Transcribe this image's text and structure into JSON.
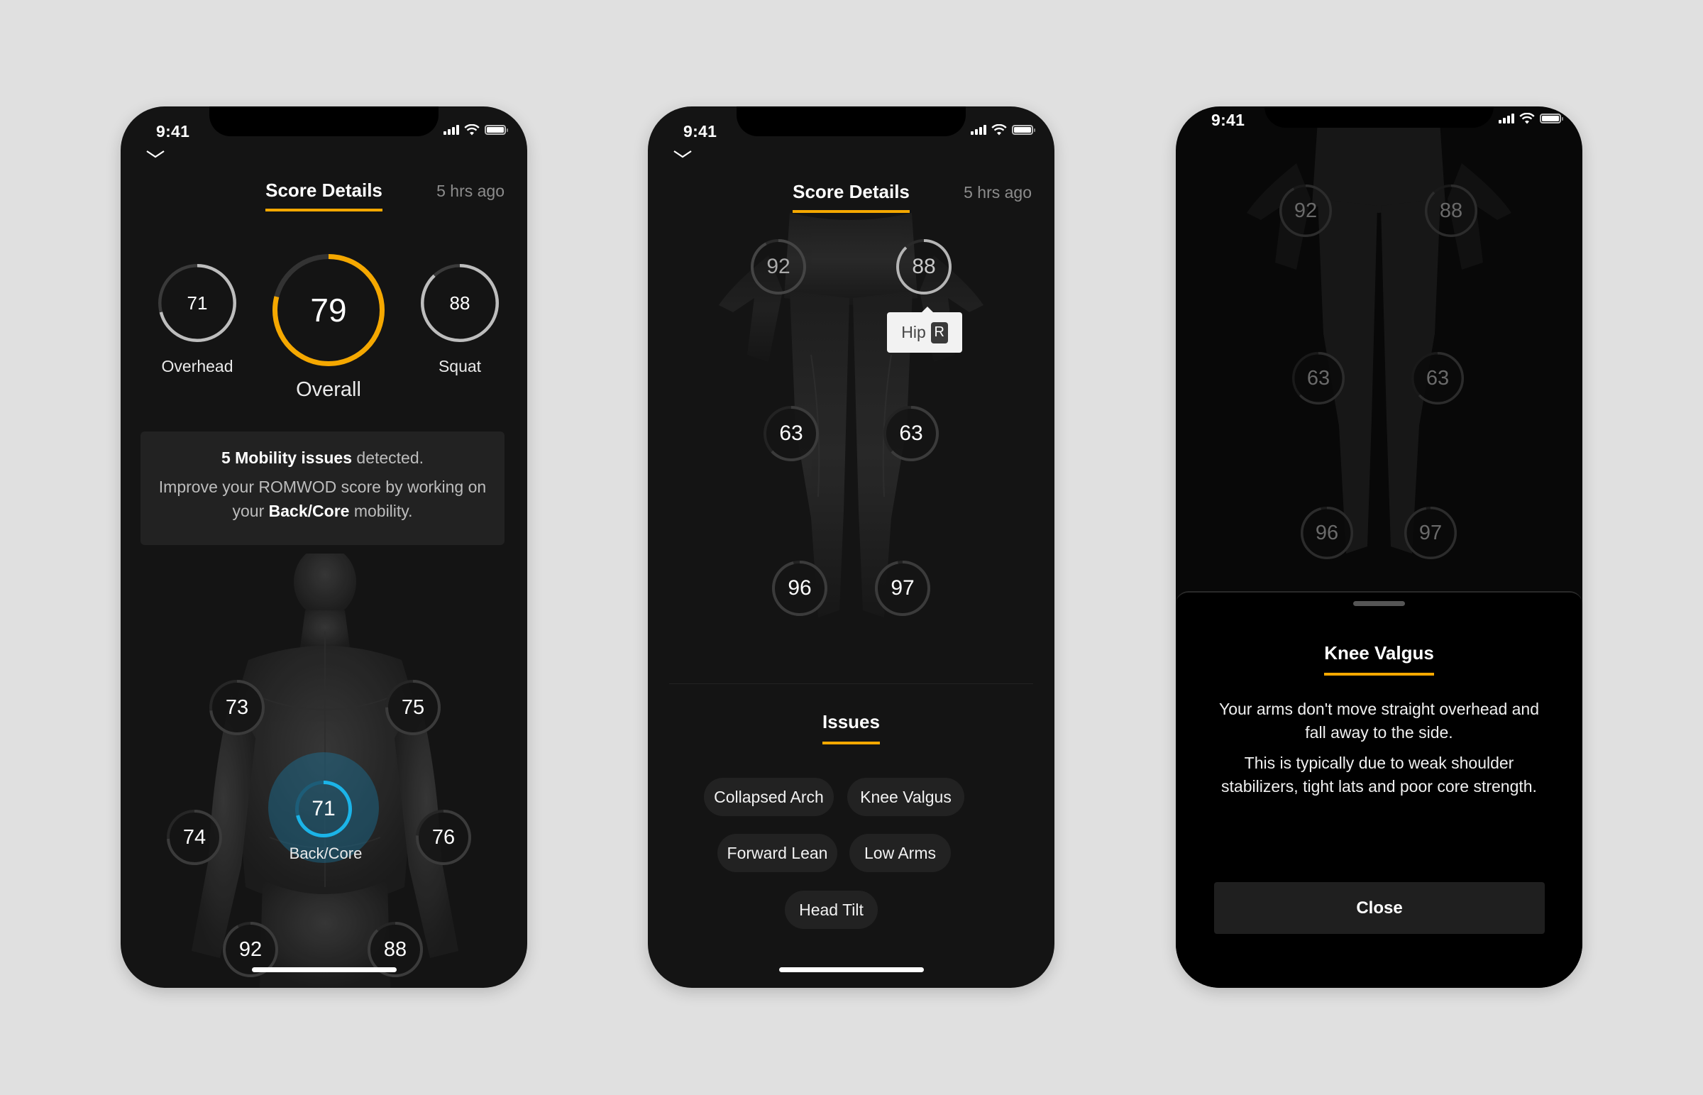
{
  "colors": {
    "accent": "#f5a800",
    "selected": "#1bb4e8",
    "ring_track": "#3a3a3a",
    "ring_fill": "#bdbdbd",
    "background": "#e0e0e0",
    "screen": "#141414"
  },
  "status_bar": {
    "time": "9:41"
  },
  "screens": [
    {
      "header": {
        "title": "Score Details",
        "timestamp": "5 hrs ago"
      },
      "scores": {
        "overhead": {
          "label": "Overhead",
          "value": "71",
          "fraction": 0.71
        },
        "overall": {
          "label": "Overall",
          "value": "79",
          "fraction": 0.79
        },
        "squat": {
          "label": "Squat",
          "value": "88",
          "fraction": 0.88
        }
      },
      "info": {
        "count_bold": "5 Mobility issues",
        "count_rest": " detected.",
        "improve_pre": "Improve your ROMWOD score by working on your ",
        "improve_bold": "Back/Core",
        "improve_post": " mobility."
      },
      "body_points": [
        {
          "id": "shoulder-left",
          "value": "73",
          "fraction": 0.73
        },
        {
          "id": "shoulder-right",
          "value": "75",
          "fraction": 0.75
        },
        {
          "id": "elbow-left",
          "value": "74",
          "fraction": 0.74
        },
        {
          "id": "elbow-right",
          "value": "76",
          "fraction": 0.76
        },
        {
          "id": "back-core",
          "value": "71",
          "fraction": 0.71,
          "label": "Back/Core",
          "selected": true
        },
        {
          "id": "hip-left",
          "value": "92",
          "fraction": 0.92
        },
        {
          "id": "hip-right",
          "value": "88",
          "fraction": 0.88
        }
      ]
    },
    {
      "header": {
        "title": "Score Details",
        "timestamp": "5 hrs ago"
      },
      "body_points": [
        {
          "id": "hip-left",
          "value": "92",
          "fraction": 0.92
        },
        {
          "id": "hip-right",
          "value": "88",
          "fraction": 0.88,
          "highlighted": true
        },
        {
          "id": "knee-left",
          "value": "63",
          "fraction": 0.63
        },
        {
          "id": "knee-right",
          "value": "63",
          "fraction": 0.63
        },
        {
          "id": "ankle-left",
          "value": "96",
          "fraction": 0.96
        },
        {
          "id": "ankle-right",
          "value": "97",
          "fraction": 0.97
        }
      ],
      "tooltip": {
        "label": "Hip",
        "side": "R"
      },
      "issues": {
        "title": "Issues",
        "items": [
          "Collapsed Arch",
          "Knee Valgus",
          "Forward Lean",
          "Low Arms",
          "Head Tilt"
        ]
      }
    },
    {
      "body_points": [
        {
          "id": "hip-left",
          "value": "92",
          "fraction": 0.92
        },
        {
          "id": "hip-right",
          "value": "88",
          "fraction": 0.88
        },
        {
          "id": "knee-left",
          "value": "63",
          "fraction": 0.63
        },
        {
          "id": "knee-right",
          "value": "63",
          "fraction": 0.63
        },
        {
          "id": "ankle-left",
          "value": "96",
          "fraction": 0.96
        },
        {
          "id": "ankle-right",
          "value": "97",
          "fraction": 0.97
        }
      ],
      "sheet": {
        "title": "Knee Valgus",
        "paragraph1": "Your arms don't move straight overhead and fall away to the side.",
        "paragraph2": "This is typically due to weak shoulder stabilizers, tight lats and poor core strength.",
        "close_label": "Close"
      }
    }
  ]
}
